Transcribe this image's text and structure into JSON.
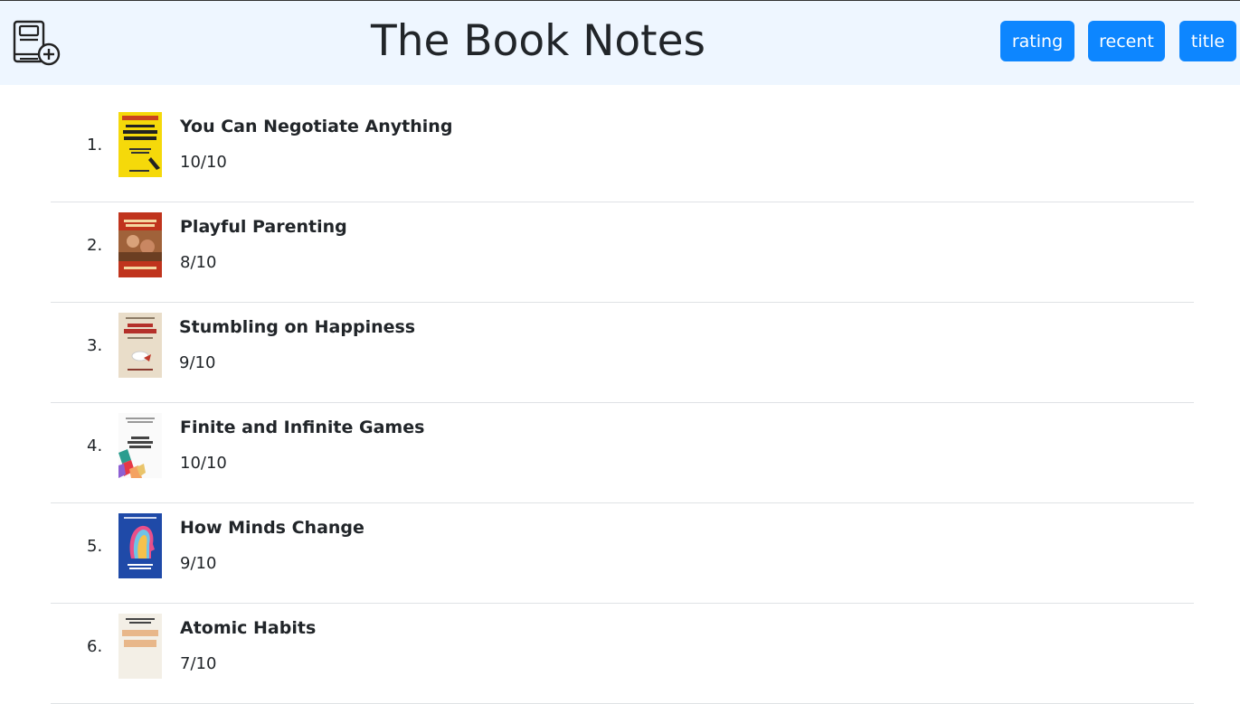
{
  "header": {
    "title": "The Book Notes",
    "add_icon": "add-book-icon"
  },
  "sort": {
    "rating_label": "rating",
    "recent_label": "recent",
    "title_label": "title"
  },
  "colors": {
    "header_bg": "#eef6ff",
    "button_bg": "#0d86ff",
    "button_text": "#ffffff"
  },
  "books": [
    {
      "number": "1.",
      "title": "You Can Negotiate Anything",
      "rating": "10/10"
    },
    {
      "number": "2.",
      "title": "Playful Parenting",
      "rating": "8/10"
    },
    {
      "number": "3.",
      "title": "Stumbling on Happiness",
      "rating": "9/10"
    },
    {
      "number": "4.",
      "title": "Finite and Infinite Games",
      "rating": "10/10"
    },
    {
      "number": "5.",
      "title": "How Minds Change",
      "rating": "9/10"
    },
    {
      "number": "6.",
      "title": "Atomic Habits",
      "rating": "7/10"
    }
  ]
}
